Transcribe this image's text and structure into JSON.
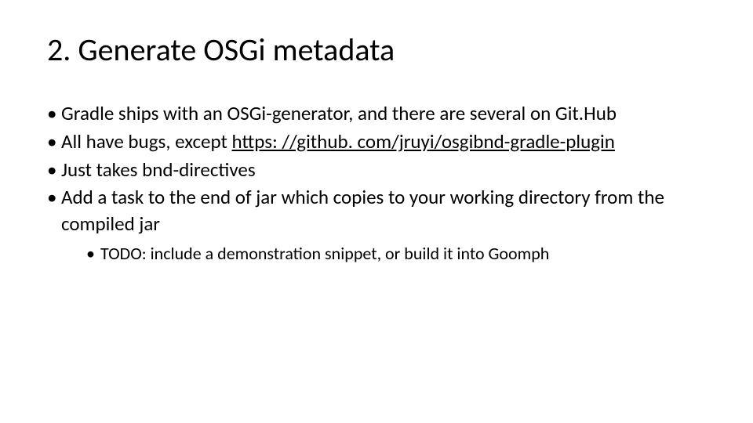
{
  "title": "2. Generate OSGi metadata",
  "bullets": {
    "b1": "Gradle ships with an OSGi-generator, and there are several on Git.Hub",
    "b2_prefix": "All have bugs, except ",
    "b2_link": "https: //github. com/jruyi/osgibnd-gradle-plugin",
    "b3": "Just takes bnd-directives",
    "b4": "Add a task to the end of jar which copies to your working directory from the compiled jar",
    "sub1": "TODO: include a demonstration snippet, or build it into Goomph"
  }
}
